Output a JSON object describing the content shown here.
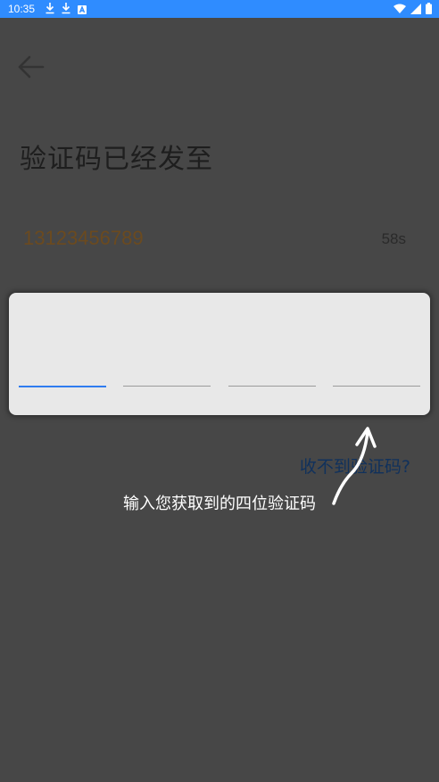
{
  "status_bar": {
    "time": "10:35",
    "icons": [
      "download-icon",
      "download-icon",
      "a-icon",
      "wifi-icon",
      "signal-icon",
      "battery-icon"
    ],
    "color": "#2f8cff"
  },
  "header": {
    "back_icon": "arrow-left-icon"
  },
  "main": {
    "title": "验证码已经发至",
    "phone": "13123456789",
    "countdown": "58s",
    "code_slots": 4,
    "not_received_link": "收不到验证码?"
  },
  "overlay": {
    "hint": "输入您获取到的四位验证码"
  },
  "colors": {
    "accent": "#2f7cf0",
    "overlay": "#474747",
    "phone": "#6b4a1f",
    "link": "#10315c"
  }
}
